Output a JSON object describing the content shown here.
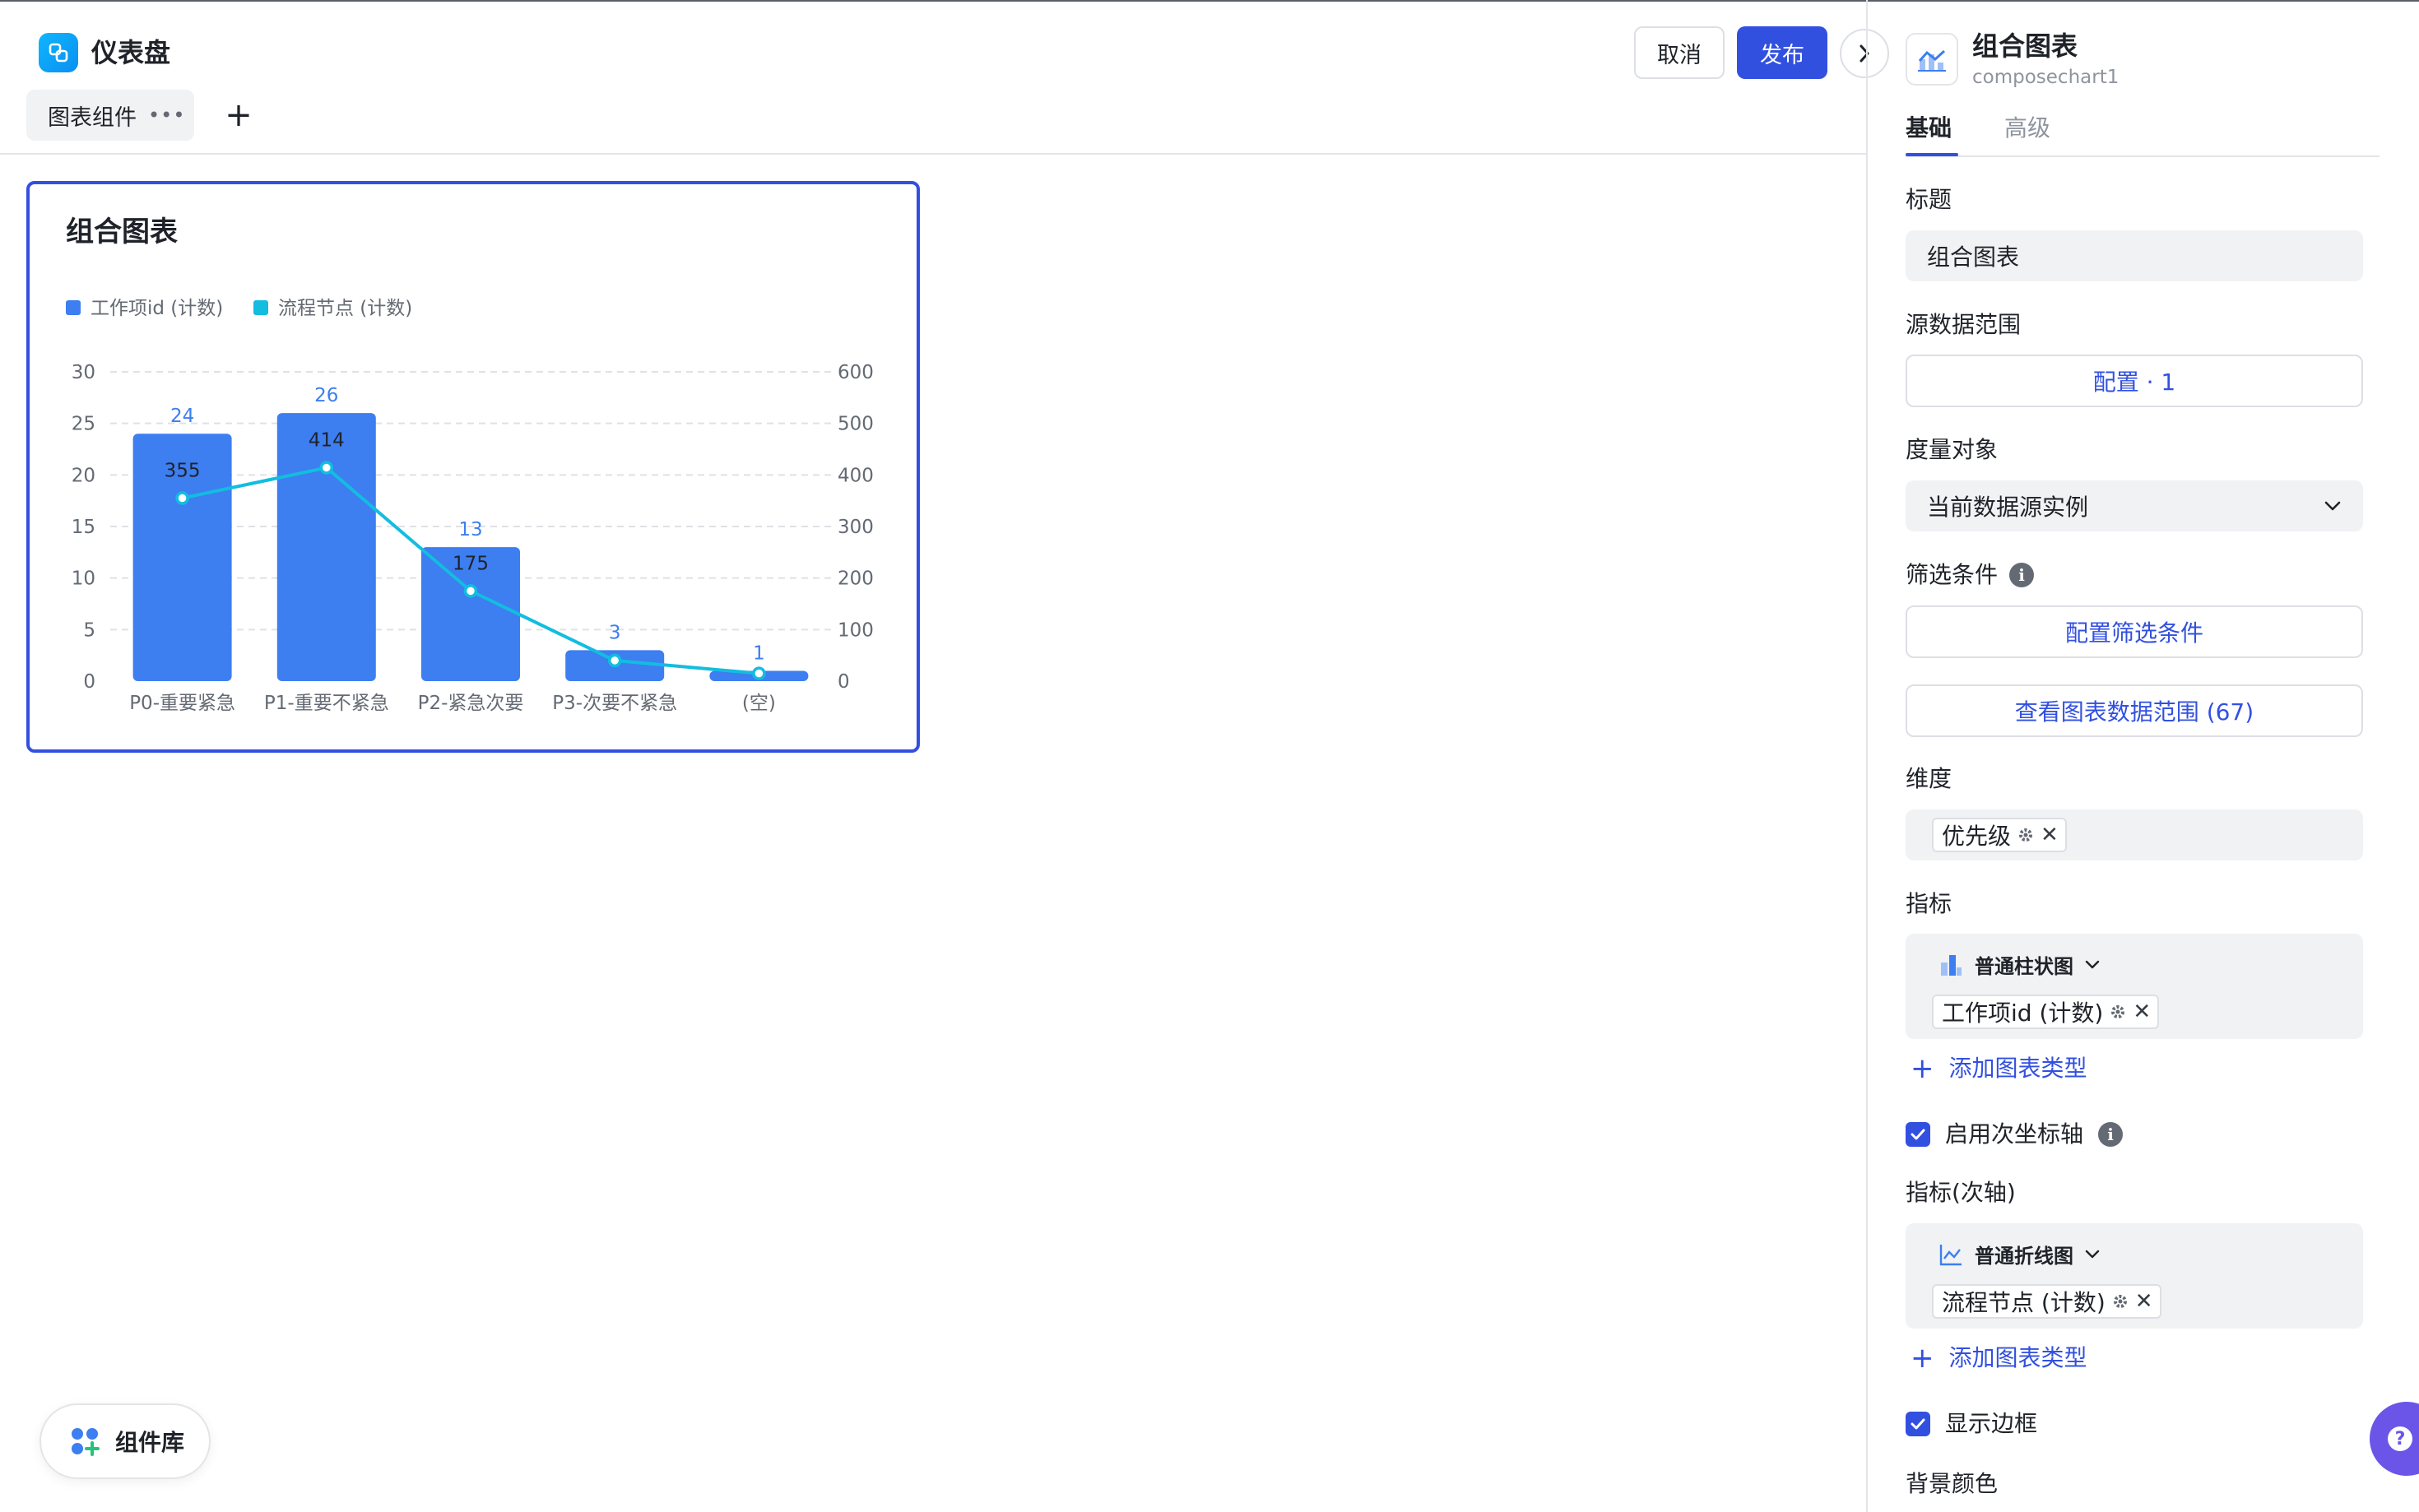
{
  "app": {
    "title": "仪表盘"
  },
  "tabs": {
    "active_label": "图表组件",
    "more": "•••",
    "add": "+"
  },
  "actions": {
    "cancel": "取消",
    "publish": "发布"
  },
  "chart_card": {
    "title": "组合图表"
  },
  "chart_data": {
    "type": "bar",
    "categories": [
      "P0-重要紧急",
      "P1-重要不紧急",
      "P2-紧急次要",
      "P3-次要不紧急",
      "(空)"
    ],
    "series": [
      {
        "name": "工作项id (计数)",
        "type": "bar",
        "axis": "left",
        "values": [
          24,
          26,
          13,
          3,
          1
        ],
        "color": "#3d7ef0"
      },
      {
        "name": "流程节点 (计数)",
        "type": "line",
        "axis": "right",
        "values": [
          355,
          414,
          175,
          40,
          15
        ],
        "labels": [
          "355",
          "414",
          "175",
          "",
          ""
        ],
        "color": "#12bde0"
      }
    ],
    "left_axis": {
      "ylim": [
        0,
        30
      ],
      "ticks": [
        0,
        5,
        10,
        15,
        20,
        25,
        30
      ]
    },
    "right_axis": {
      "ylim": [
        0,
        600
      ],
      "ticks": [
        0,
        100,
        200,
        300,
        400,
        500,
        600
      ]
    },
    "legend": "top-left",
    "grid": true
  },
  "component_library": {
    "label": "组件库"
  },
  "panel": {
    "title": "组合图表",
    "subtitle": "composechart1",
    "tabs": {
      "basic": "基础",
      "advanced": "高级"
    },
    "title_label": "标题",
    "title_value": "组合图表",
    "source_label": "源数据范围",
    "source_button": "配置 · 1",
    "measure_label": "度量对象",
    "measure_value": "当前数据源实例",
    "filter_label": "筛选条件",
    "filter_button": "配置筛选条件",
    "view_range_button": "查看图表数据范围 (67)",
    "dimension_label": "维度",
    "dimension_tag": "优先级",
    "metric_label": "指标",
    "metric_type": "普通柱状图",
    "metric_tag": "工作项id (计数)",
    "add_chart_type": "添加图表类型",
    "secondary_axis_label": "启用次坐标轴",
    "secondary_metric_label": "指标(次轴)",
    "secondary_metric_type": "普通折线图",
    "secondary_metric_tag": "流程节点 (计数)",
    "add_chart_type_2": "添加图表类型",
    "show_border_label": "显示边框",
    "background_label": "背景颜色"
  },
  "colors": {
    "accent": "#3250e0",
    "bar": "#3d7ef0",
    "line": "#12bde0"
  }
}
